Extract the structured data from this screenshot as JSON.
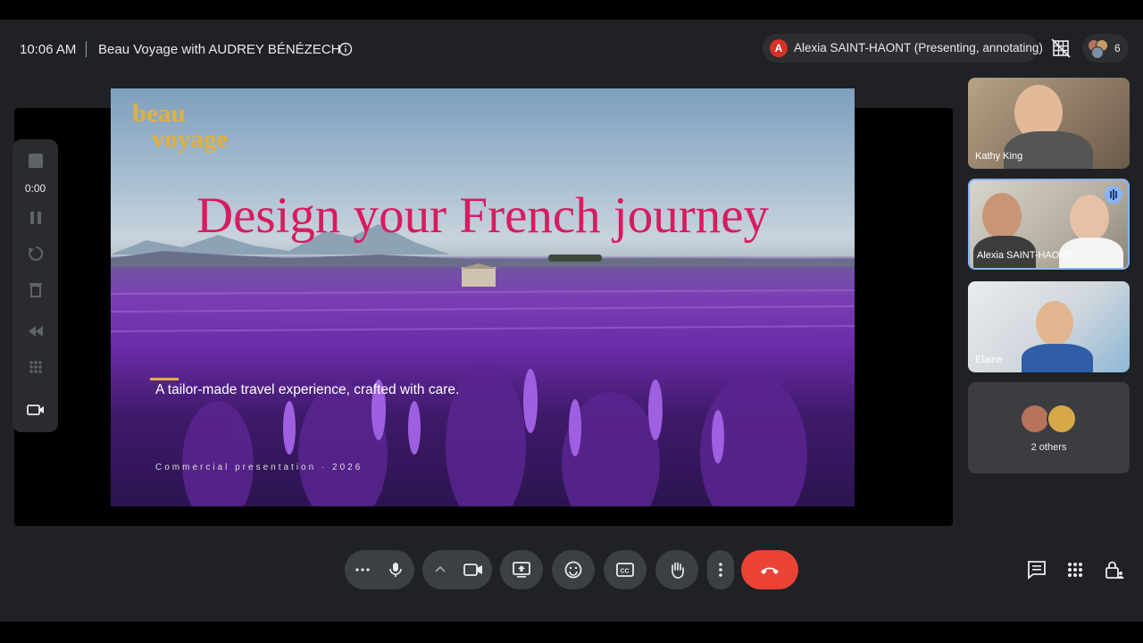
{
  "header": {
    "time": "10:06 AM",
    "meeting_title": "Beau Voyage with AUDREY BÉNÉZECH",
    "presenter_initial": "A",
    "presenter_label": "Alexia SAINT-HAONT (Presenting, annotating)",
    "participant_count": "6"
  },
  "slide": {
    "logo_line1": "beau",
    "logo_line2": "voyage",
    "title": "Design your French journey",
    "tagline": "A tailor-made travel experience, crafted with care.",
    "footer": "Commercial presentation · 2026"
  },
  "recording": {
    "elapsed": "0:00"
  },
  "participants": [
    {
      "name": "Kathy King"
    },
    {
      "name": "Alexia SAINT-HAONT"
    },
    {
      "name": "Elaine"
    }
  ],
  "others_label": "2 others",
  "colors": {
    "end_call": "#ea4335",
    "active_tile_border": "#8ab4f8",
    "slide_title": "#d81b60",
    "logo": "#e3b03c"
  }
}
